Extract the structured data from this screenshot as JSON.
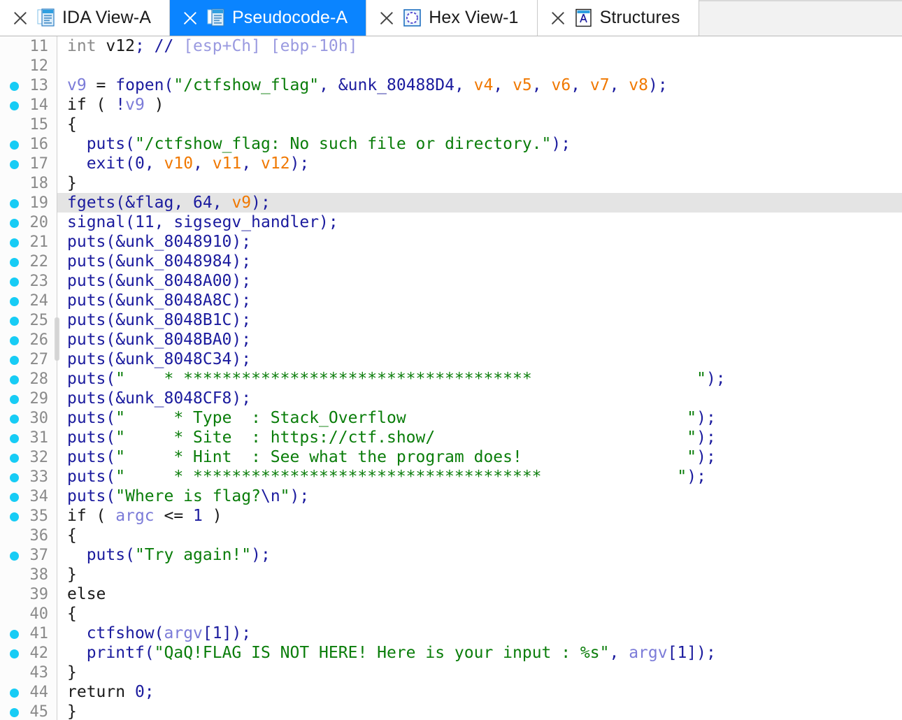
{
  "window": {
    "title": "IDA View / Pseudocode-A"
  },
  "tabs": [
    {
      "label": "IDA View-A",
      "icon": "document-icon",
      "active": false,
      "close_label": "×"
    },
    {
      "label": "Pseudocode-A",
      "icon": "document-icon",
      "active": true,
      "close_label": "×"
    },
    {
      "label": "Hex View-1",
      "icon": "hex-circle-icon",
      "active": false,
      "close_label": "×"
    },
    {
      "label": "Structures",
      "icon": "structures-icon",
      "active": false,
      "close_label": "×"
    }
  ],
  "editor": {
    "highlighted_line": 19,
    "colors": {
      "string": "#0a7d0a",
      "keyword": "#1b1b9e",
      "local_var": "#7b7bd8",
      "register": "#f07800",
      "comment": "#9a9ae0",
      "breakpoint_dot": "#17ccf5",
      "active_tab": "#0a84ff",
      "highlight_row": "#e4e4e4"
    },
    "lines": [
      {
        "n": 11,
        "dot": false,
        "text": "int v12; // [esp+Ch] [ebp-10h]"
      },
      {
        "n": 12,
        "dot": false,
        "text": ""
      },
      {
        "n": 13,
        "dot": true,
        "text": "v9 = fopen(\"/ctfshow_flag\", &unk_80488D4, v4, v5, v6, v7, v8);"
      },
      {
        "n": 14,
        "dot": true,
        "text": "if ( !v9 )"
      },
      {
        "n": 15,
        "dot": false,
        "text": "{"
      },
      {
        "n": 16,
        "dot": true,
        "text": "  puts(\"/ctfshow_flag: No such file or directory.\");"
      },
      {
        "n": 17,
        "dot": true,
        "text": "  exit(0, v10, v11, v12);"
      },
      {
        "n": 18,
        "dot": false,
        "text": "}"
      },
      {
        "n": 19,
        "dot": true,
        "text": "fgets(&flag, 64, v9);"
      },
      {
        "n": 20,
        "dot": true,
        "text": "signal(11, sigsegv_handler);"
      },
      {
        "n": 21,
        "dot": true,
        "text": "puts(&unk_8048910);"
      },
      {
        "n": 22,
        "dot": true,
        "text": "puts(&unk_8048984);"
      },
      {
        "n": 23,
        "dot": true,
        "text": "puts(&unk_8048A00);"
      },
      {
        "n": 24,
        "dot": true,
        "text": "puts(&unk_8048A8C);"
      },
      {
        "n": 25,
        "dot": true,
        "text": "puts(&unk_8048B1C);"
      },
      {
        "n": 26,
        "dot": true,
        "text": "puts(&unk_8048BA0);"
      },
      {
        "n": 27,
        "dot": true,
        "text": "puts(&unk_8048C34);"
      },
      {
        "n": 28,
        "dot": true,
        "text": "puts(\"    * ************************************                 \");"
      },
      {
        "n": 29,
        "dot": true,
        "text": "puts(&unk_8048CF8);"
      },
      {
        "n": 30,
        "dot": true,
        "text": "puts(\"     * Type  : Stack_Overflow                             \");"
      },
      {
        "n": 31,
        "dot": true,
        "text": "puts(\"     * Site  : https://ctf.show/                           \");"
      },
      {
        "n": 32,
        "dot": true,
        "text": "puts(\"     * Hint  : See what the program does!                   \");"
      },
      {
        "n": 33,
        "dot": true,
        "text": "puts(\"     * ************************************                 \");"
      },
      {
        "n": 34,
        "dot": true,
        "text": "puts(\"Where is flag?\\n\");"
      },
      {
        "n": 35,
        "dot": true,
        "text": "if ( argc <= 1 )"
      },
      {
        "n": 36,
        "dot": false,
        "text": "{"
      },
      {
        "n": 37,
        "dot": true,
        "text": "  puts(\"Try again!\");"
      },
      {
        "n": 38,
        "dot": false,
        "text": "}"
      },
      {
        "n": 39,
        "dot": false,
        "text": "else"
      },
      {
        "n": 40,
        "dot": false,
        "text": "{"
      },
      {
        "n": 41,
        "dot": true,
        "text": "  ctfshow(argv[1]);"
      },
      {
        "n": 42,
        "dot": true,
        "text": "  printf(\"QaQ!FLAG IS NOT HERE! Here is your input : %s\", argv[1]);"
      },
      {
        "n": 43,
        "dot": false,
        "text": "}"
      },
      {
        "n": 44,
        "dot": true,
        "text": "return 0;"
      },
      {
        "n": 45,
        "dot": true,
        "text": "}"
      }
    ],
    "tokens": [
      [
        {
          "t": "int ",
          "c": "cmt"
        },
        {
          "t": "v12",
          "c": "plain"
        },
        {
          "t": ";",
          "c": "kw"
        },
        {
          "t": " ",
          "c": "plain"
        },
        {
          "t": "//",
          "c": "kw"
        },
        {
          "t": " [esp+Ch] [ebp-10h]",
          "c": "cmtclr"
        }
      ],
      [],
      [
        {
          "t": "v9",
          "c": "var"
        },
        {
          "t": " = ",
          "c": "plain"
        },
        {
          "t": "fopen",
          "c": "fn"
        },
        {
          "t": "(",
          "c": "kw"
        },
        {
          "t": "\"/ctfshow_flag\"",
          "c": "str"
        },
        {
          "t": ", ",
          "c": "kw"
        },
        {
          "t": "&unk_80488D4",
          "c": "kw"
        },
        {
          "t": ", ",
          "c": "kw"
        },
        {
          "t": "v4",
          "c": "reg"
        },
        {
          "t": ", ",
          "c": "kw"
        },
        {
          "t": "v5",
          "c": "reg"
        },
        {
          "t": ", ",
          "c": "kw"
        },
        {
          "t": "v6",
          "c": "reg"
        },
        {
          "t": ", ",
          "c": "kw"
        },
        {
          "t": "v7",
          "c": "reg"
        },
        {
          "t": ", ",
          "c": "kw"
        },
        {
          "t": "v8",
          "c": "reg"
        },
        {
          "t": ");",
          "c": "kw"
        }
      ],
      [
        {
          "t": "if ( ",
          "c": "plain"
        },
        {
          "t": "!",
          "c": "kw"
        },
        {
          "t": "v9",
          "c": "var"
        },
        {
          "t": " )",
          "c": "plain"
        }
      ],
      [
        {
          "t": "{",
          "c": "plain"
        }
      ],
      [
        {
          "t": "  ",
          "c": "plain"
        },
        {
          "t": "puts",
          "c": "fn"
        },
        {
          "t": "(",
          "c": "kw"
        },
        {
          "t": "\"/ctfshow_flag: No such file or directory.\"",
          "c": "str"
        },
        {
          "t": ");",
          "c": "kw"
        }
      ],
      [
        {
          "t": "  ",
          "c": "plain"
        },
        {
          "t": "exit",
          "c": "fn"
        },
        {
          "t": "(",
          "c": "kw"
        },
        {
          "t": "0",
          "c": "kw"
        },
        {
          "t": ", ",
          "c": "kw"
        },
        {
          "t": "v10",
          "c": "reg"
        },
        {
          "t": ", ",
          "c": "kw"
        },
        {
          "t": "v11",
          "c": "reg"
        },
        {
          "t": ", ",
          "c": "kw"
        },
        {
          "t": "v12",
          "c": "reg"
        },
        {
          "t": ");",
          "c": "kw"
        }
      ],
      [
        {
          "t": "}",
          "c": "plain"
        }
      ],
      [
        {
          "t": "fgets",
          "c": "fn"
        },
        {
          "t": "(&flag, ",
          "c": "kw"
        },
        {
          "t": "64",
          "c": "kw"
        },
        {
          "t": ", ",
          "c": "kw"
        },
        {
          "t": "v9",
          "c": "reg"
        },
        {
          "t": ");",
          "c": "kw"
        }
      ],
      [
        {
          "t": "signal",
          "c": "fn"
        },
        {
          "t": "(",
          "c": "kw"
        },
        {
          "t": "11",
          "c": "kw"
        },
        {
          "t": ", sigsegv_handler);",
          "c": "kw"
        }
      ],
      [
        {
          "t": "puts",
          "c": "fn"
        },
        {
          "t": "(&unk_8048910);",
          "c": "kw"
        }
      ],
      [
        {
          "t": "puts",
          "c": "fn"
        },
        {
          "t": "(&unk_8048984);",
          "c": "kw"
        }
      ],
      [
        {
          "t": "puts",
          "c": "fn"
        },
        {
          "t": "(&unk_8048A00);",
          "c": "kw"
        }
      ],
      [
        {
          "t": "puts",
          "c": "fn"
        },
        {
          "t": "(&unk_8048A8C);",
          "c": "kw"
        }
      ],
      [
        {
          "t": "puts",
          "c": "fn"
        },
        {
          "t": "(&unk_8048B1C);",
          "c": "kw"
        }
      ],
      [
        {
          "t": "puts",
          "c": "fn"
        },
        {
          "t": "(&unk_8048BA0);",
          "c": "kw"
        }
      ],
      [
        {
          "t": "puts",
          "c": "fn"
        },
        {
          "t": "(&unk_8048C34);",
          "c": "kw"
        }
      ],
      [
        {
          "t": "puts",
          "c": "fn"
        },
        {
          "t": "(",
          "c": "kw"
        },
        {
          "t": "\"    * ************************************                 \"",
          "c": "str"
        },
        {
          "t": ");",
          "c": "kw"
        }
      ],
      [
        {
          "t": "puts",
          "c": "fn"
        },
        {
          "t": "(&unk_8048CF8);",
          "c": "kw"
        }
      ],
      [
        {
          "t": "puts",
          "c": "fn"
        },
        {
          "t": "(",
          "c": "kw"
        },
        {
          "t": "\"     * Type  : Stack_Overflow                             \"",
          "c": "str"
        },
        {
          "t": ");",
          "c": "kw"
        }
      ],
      [
        {
          "t": "puts",
          "c": "fn"
        },
        {
          "t": "(",
          "c": "kw"
        },
        {
          "t": "\"     * Site  : https://ctf.show/                          \"",
          "c": "str"
        },
        {
          "t": ");",
          "c": "kw"
        }
      ],
      [
        {
          "t": "puts",
          "c": "fn"
        },
        {
          "t": "(",
          "c": "kw"
        },
        {
          "t": "\"     * Hint  : See what the program does!                 \"",
          "c": "str"
        },
        {
          "t": ");",
          "c": "kw"
        }
      ],
      [
        {
          "t": "puts",
          "c": "fn"
        },
        {
          "t": "(",
          "c": "kw"
        },
        {
          "t": "\"     * ************************************              \"",
          "c": "str"
        },
        {
          "t": ");",
          "c": "kw"
        }
      ],
      [
        {
          "t": "puts",
          "c": "fn"
        },
        {
          "t": "(",
          "c": "kw"
        },
        {
          "t": "\"Where is flag?",
          "c": "str"
        },
        {
          "t": "\\n",
          "c": "esc"
        },
        {
          "t": "\"",
          "c": "str"
        },
        {
          "t": ");",
          "c": "kw"
        }
      ],
      [
        {
          "t": "if ( ",
          "c": "plain"
        },
        {
          "t": "argc",
          "c": "var"
        },
        {
          "t": " <= ",
          "c": "plain"
        },
        {
          "t": "1",
          "c": "kw"
        },
        {
          "t": " )",
          "c": "plain"
        }
      ],
      [
        {
          "t": "{",
          "c": "plain"
        }
      ],
      [
        {
          "t": "  ",
          "c": "plain"
        },
        {
          "t": "puts",
          "c": "fn"
        },
        {
          "t": "(",
          "c": "kw"
        },
        {
          "t": "\"Try again!\"",
          "c": "str"
        },
        {
          "t": ");",
          "c": "kw"
        }
      ],
      [
        {
          "t": "}",
          "c": "plain"
        }
      ],
      [
        {
          "t": "else",
          "c": "plain"
        }
      ],
      [
        {
          "t": "{",
          "c": "plain"
        }
      ],
      [
        {
          "t": "  ",
          "c": "plain"
        },
        {
          "t": "ctfshow",
          "c": "fn"
        },
        {
          "t": "(",
          "c": "kw"
        },
        {
          "t": "argv",
          "c": "var"
        },
        {
          "t": "[",
          "c": "kw"
        },
        {
          "t": "1",
          "c": "kw"
        },
        {
          "t": "]);",
          "c": "kw"
        }
      ],
      [
        {
          "t": "  ",
          "c": "plain"
        },
        {
          "t": "printf",
          "c": "fn"
        },
        {
          "t": "(",
          "c": "kw"
        },
        {
          "t": "\"QaQ!FLAG IS NOT HERE! Here is your input : %s\"",
          "c": "str"
        },
        {
          "t": ", ",
          "c": "kw"
        },
        {
          "t": "argv",
          "c": "var"
        },
        {
          "t": "[",
          "c": "kw"
        },
        {
          "t": "1",
          "c": "kw"
        },
        {
          "t": "]);",
          "c": "kw"
        }
      ],
      [
        {
          "t": "}",
          "c": "plain"
        }
      ],
      [
        {
          "t": "return ",
          "c": "plain"
        },
        {
          "t": "0",
          "c": "kw"
        },
        {
          "t": ";",
          "c": "kw"
        }
      ],
      [
        {
          "t": "}",
          "c": "plain"
        }
      ]
    ]
  }
}
